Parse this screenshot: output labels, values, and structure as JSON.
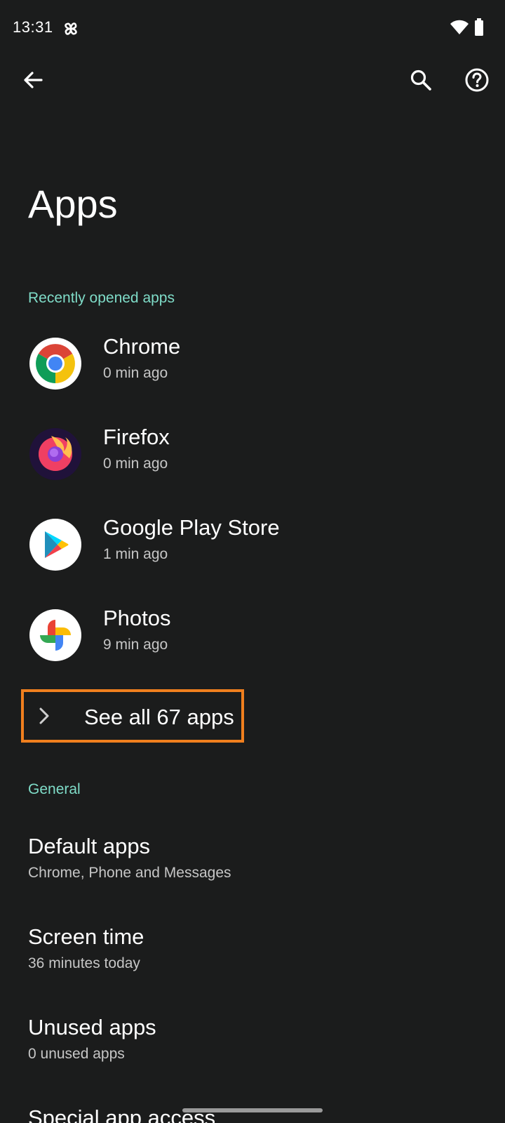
{
  "status_bar": {
    "time": "13:31",
    "icons": [
      "pinwheel-icon",
      "wifi-icon",
      "battery-icon"
    ]
  },
  "toolbar": {
    "back_icon": "arrow-back-icon",
    "search_icon": "search-icon",
    "help_icon": "help-icon"
  },
  "page": {
    "title": "Apps"
  },
  "recent": {
    "header": "Recently opened apps",
    "apps": [
      {
        "name": "Chrome",
        "time": "0 min ago",
        "icon": "chrome-icon"
      },
      {
        "name": "Firefox",
        "time": "0 min ago",
        "icon": "firefox-icon"
      },
      {
        "name": "Google Play Store",
        "time": "1 min ago",
        "icon": "play-store-icon"
      },
      {
        "name": "Photos",
        "time": "9 min ago",
        "icon": "photos-icon"
      }
    ],
    "see_all": "See all 67 apps"
  },
  "general": {
    "header": "General",
    "items": [
      {
        "title": "Default apps",
        "subtitle": "Chrome, Phone and Messages"
      },
      {
        "title": "Screen time",
        "subtitle": "36 minutes today"
      },
      {
        "title": "Unused apps",
        "subtitle": "0 unused apps"
      },
      {
        "title": "Special app access"
      }
    ]
  },
  "colors": {
    "background": "#1b1c1c",
    "accent": "#7fdcc8",
    "highlight": "#f07f1e"
  }
}
